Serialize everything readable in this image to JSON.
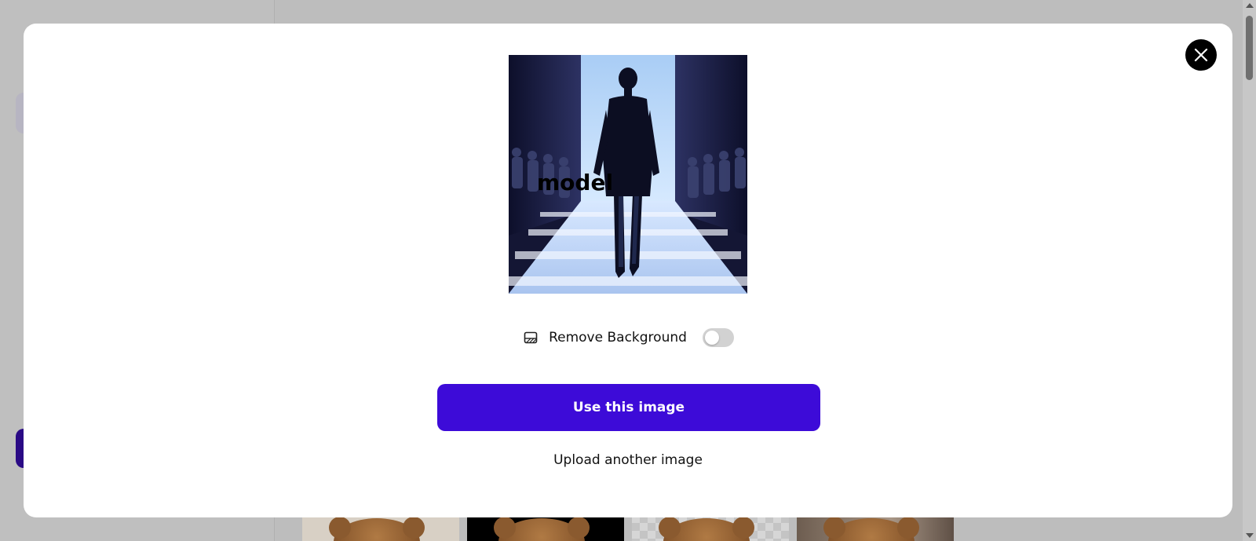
{
  "modal": {
    "preview": {
      "overlay_text": "model"
    },
    "remove_background": {
      "label": "Remove Background",
      "enabled": false,
      "icon": "image-background-icon"
    },
    "primary_button_label": "Use this image",
    "secondary_link_label": "Upload another image",
    "close_icon": "close-icon"
  },
  "colors": {
    "primary": "#3D0BD8",
    "backdrop": "#BDBDBD",
    "close_button": "#000000"
  }
}
